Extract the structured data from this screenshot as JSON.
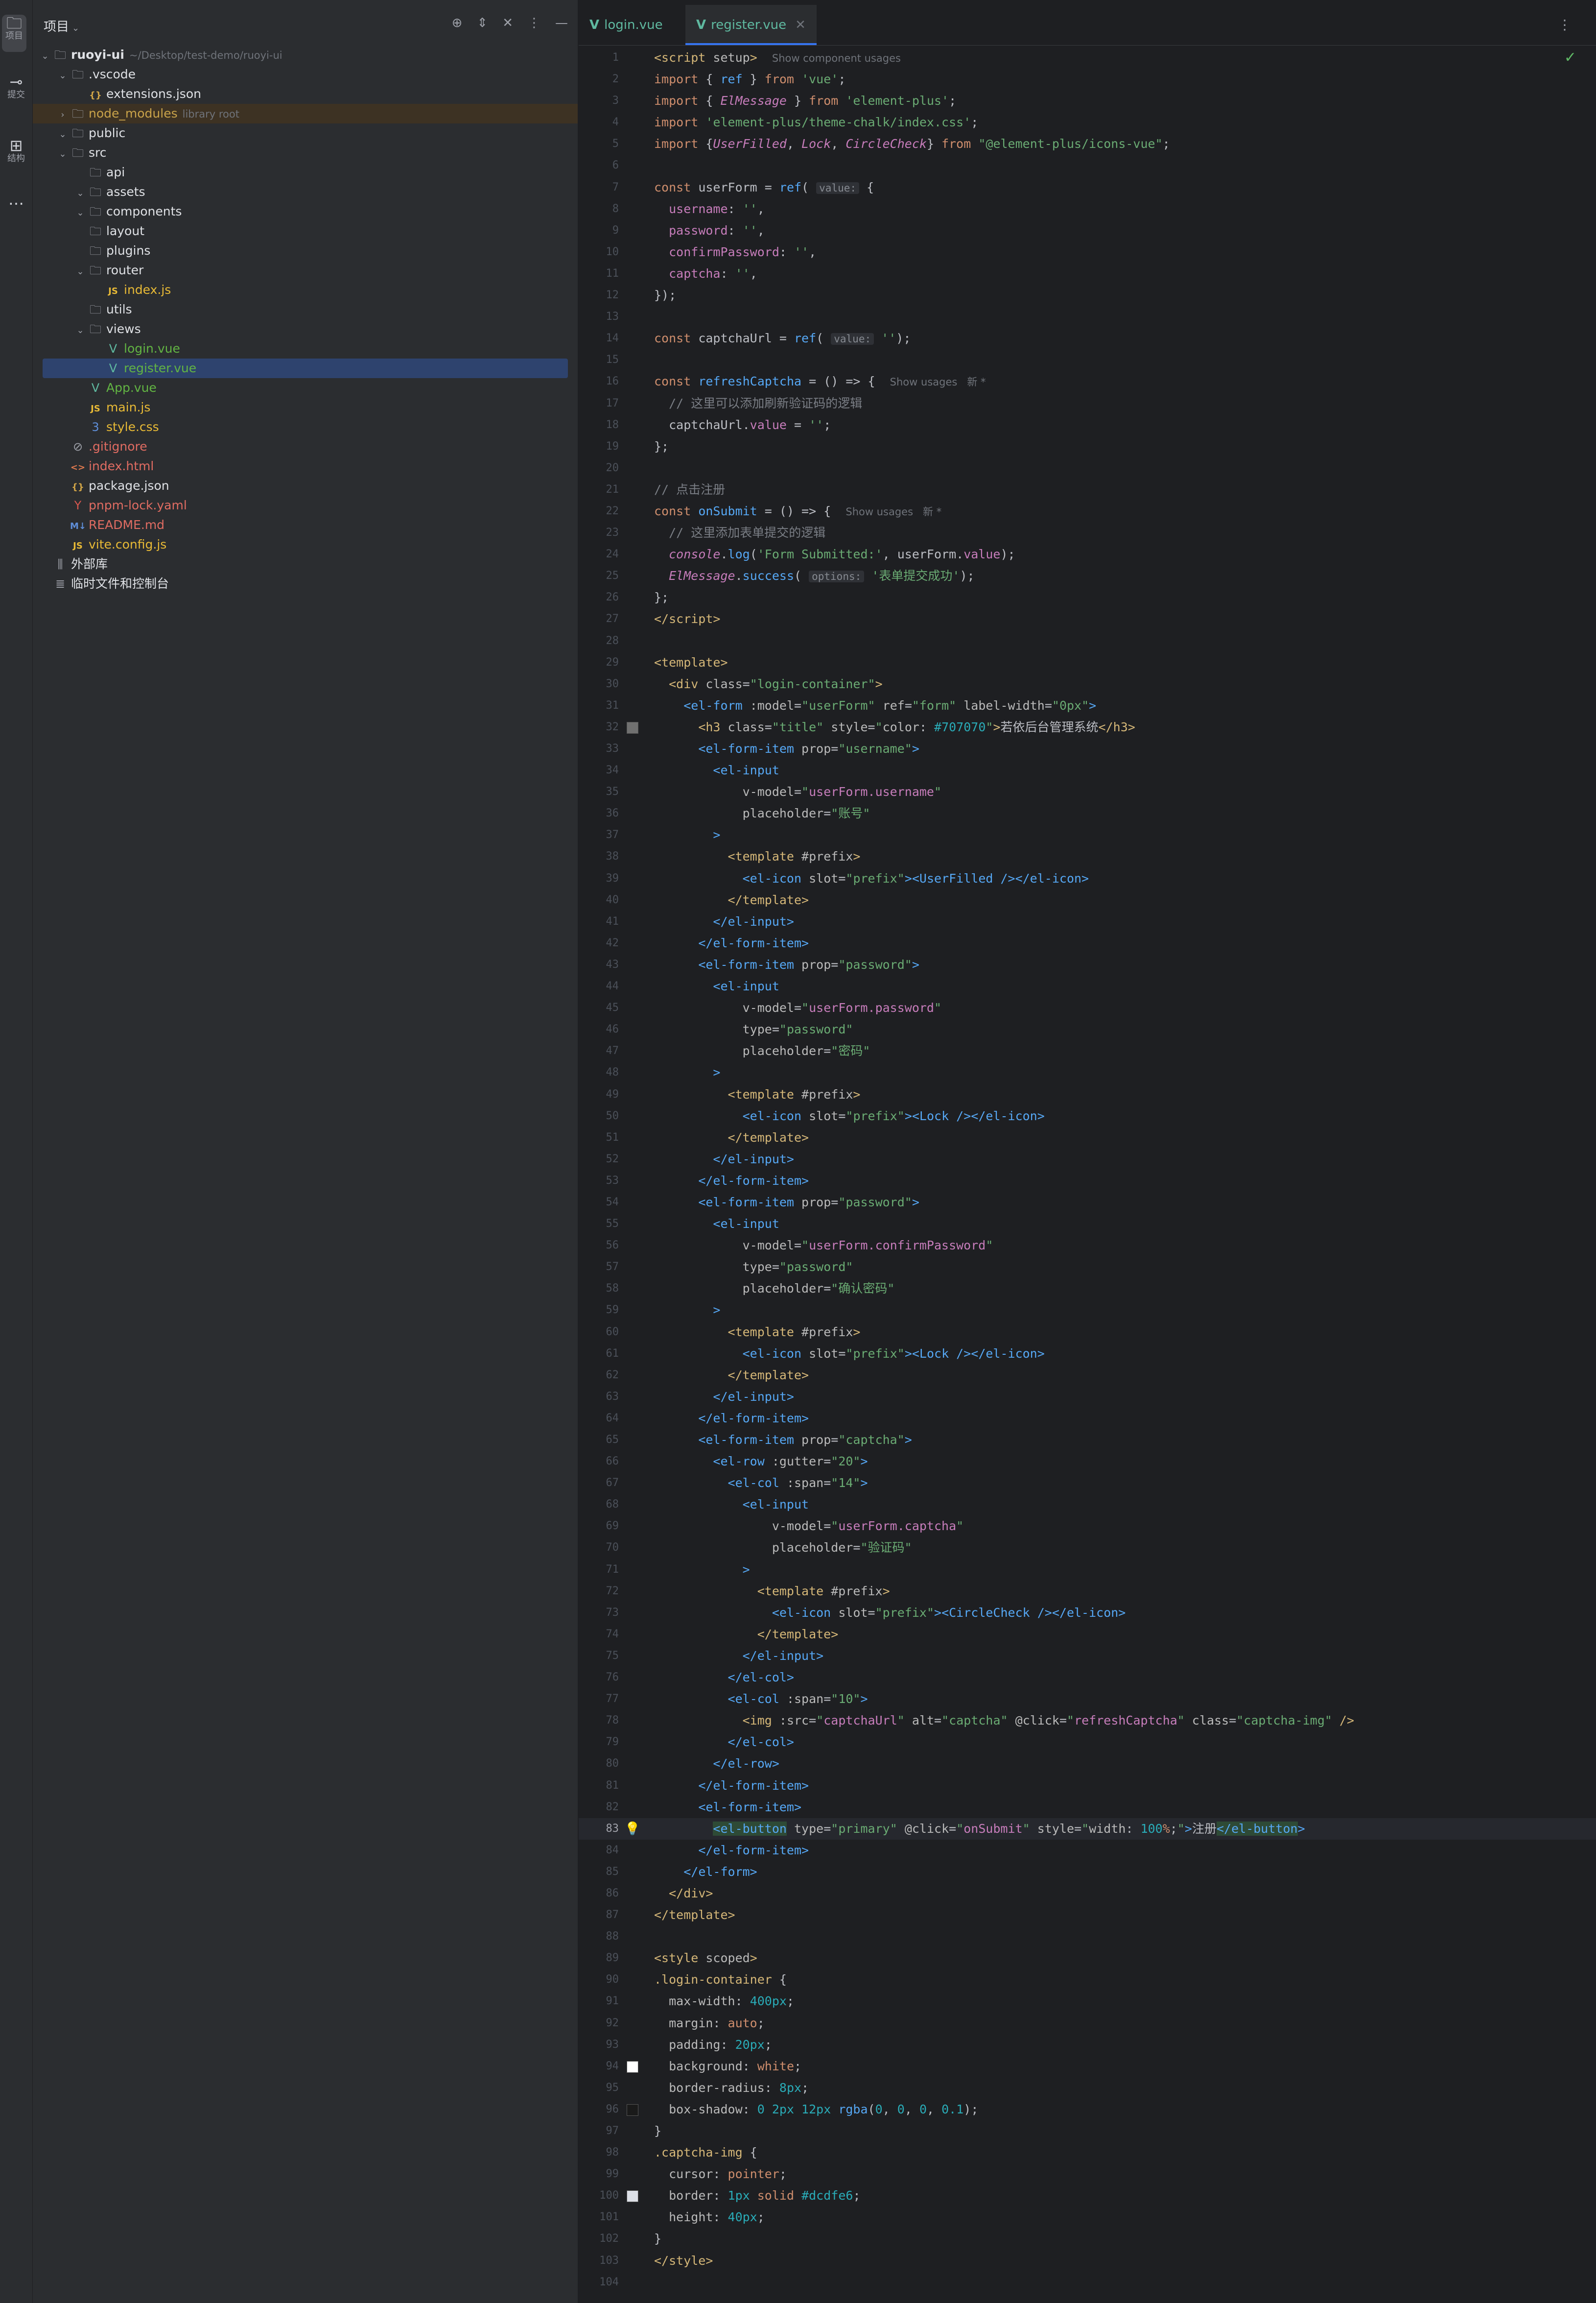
{
  "activity_bar": {
    "items": [
      {
        "icon": "folder-icon",
        "label": "项目"
      },
      {
        "icon": "commit-icon",
        "label": "提交"
      },
      {
        "icon": "structure-icon",
        "label": "结构"
      },
      {
        "icon": "more-icon",
        "label": "…"
      }
    ]
  },
  "project": {
    "title": "项目",
    "tree": [
      {
        "name": "ruoyi-ui",
        "hint": "~/Desktop/test-demo/ruoyi-ui",
        "kind": "folder",
        "indent": 0,
        "arrow": "down",
        "bold": true
      },
      {
        "name": ".vscode",
        "kind": "folder",
        "indent": 1,
        "arrow": "down"
      },
      {
        "name": "extensions.json",
        "kind": "json",
        "indent": 2
      },
      {
        "name": "node_modules",
        "hint": "library root",
        "kind": "folder",
        "indent": 1,
        "arrow": "right",
        "excluded": true
      },
      {
        "name": "public",
        "kind": "folder",
        "indent": 1,
        "arrow": "down"
      },
      {
        "name": "src",
        "kind": "folder",
        "indent": 1,
        "arrow": "down"
      },
      {
        "name": "api",
        "kind": "folder",
        "indent": 2
      },
      {
        "name": "assets",
        "kind": "folder",
        "indent": 2,
        "arrow": "down"
      },
      {
        "name": "components",
        "kind": "folder",
        "indent": 2,
        "arrow": "down"
      },
      {
        "name": "layout",
        "kind": "folder",
        "indent": 2
      },
      {
        "name": "plugins",
        "kind": "folder",
        "indent": 2
      },
      {
        "name": "router",
        "kind": "folder",
        "indent": 2,
        "arrow": "down"
      },
      {
        "name": "index.js",
        "kind": "js",
        "indent": 3
      },
      {
        "name": "utils",
        "kind": "folder",
        "indent": 2
      },
      {
        "name": "views",
        "kind": "folder",
        "indent": 2,
        "arrow": "down"
      },
      {
        "name": "login.vue",
        "kind": "vue",
        "indent": 3
      },
      {
        "name": "register.vue",
        "kind": "vue",
        "indent": 3,
        "selected": true
      },
      {
        "name": "App.vue",
        "kind": "vue",
        "indent": 2
      },
      {
        "name": "main.js",
        "kind": "js",
        "indent": 2
      },
      {
        "name": "style.css",
        "kind": "css",
        "indent": 2
      },
      {
        "name": ".gitignore",
        "kind": "git",
        "indent": 1
      },
      {
        "name": "index.html",
        "kind": "html",
        "indent": 1
      },
      {
        "name": "package.json",
        "kind": "json",
        "indent": 1
      },
      {
        "name": "pnpm-lock.yaml",
        "kind": "yaml",
        "indent": 1
      },
      {
        "name": "README.md",
        "kind": "md",
        "indent": 1
      },
      {
        "name": "vite.config.js",
        "kind": "js",
        "indent": 1
      },
      {
        "name": "外部库",
        "kind": "lib",
        "indent": 0
      },
      {
        "name": "临时文件和控制台",
        "kind": "scratch",
        "indent": 0
      }
    ]
  },
  "editor": {
    "tabs": [
      {
        "label": "login.vue",
        "active": false
      },
      {
        "label": "register.vue",
        "active": true
      }
    ],
    "current_line": 83
  }
}
